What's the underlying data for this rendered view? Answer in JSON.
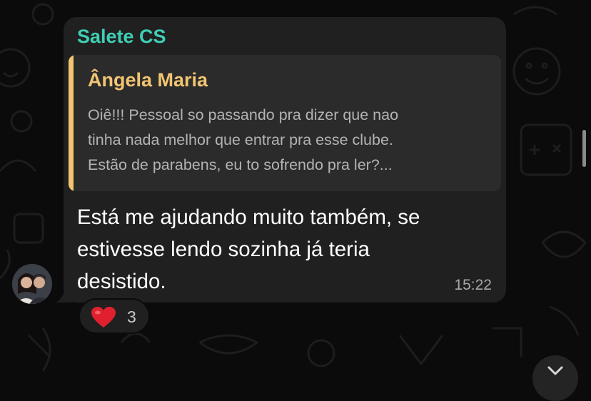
{
  "message": {
    "sender": "Salete CS",
    "quoted": {
      "author": "Ângela Maria",
      "lines": [
        "Oiê!!! Pessoal so passando pra dizer que nao",
        "tinha nada melhor que entrar pra esse clube.",
        "Estão de parabens, eu to sofrendo pra ler?..."
      ]
    },
    "text_lines": [
      "Está me ajudando muito também, se",
      "estivesse lendo sozinha já teria",
      "desistido."
    ],
    "time": "15:22",
    "reaction": {
      "icon": "heart-icon",
      "count": "3"
    }
  },
  "colors": {
    "sender": "#3fcfb4",
    "quote_author": "#f2c572",
    "bubble": "#202020",
    "background": "#0b0b0b"
  }
}
